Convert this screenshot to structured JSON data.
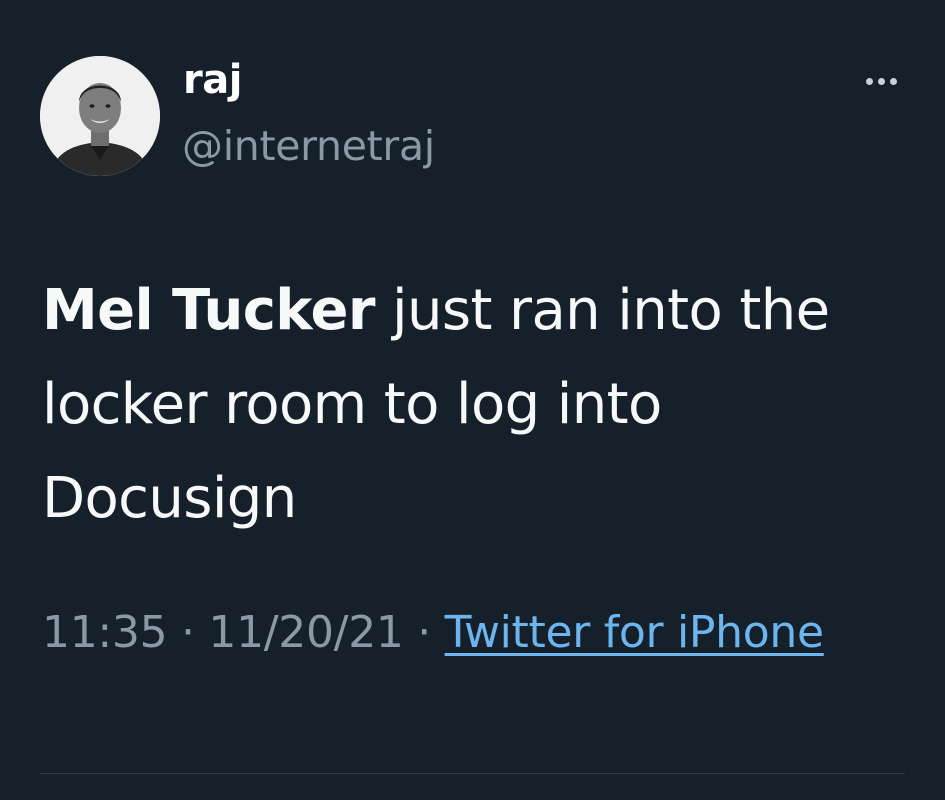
{
  "author": {
    "display_name": "raj",
    "handle": "@internetraj",
    "avatar_icon": "profile-photo"
  },
  "more_icon": "ellipsis-icon",
  "tweet": {
    "bold_text": "Mel Tucker",
    "text": " just ran into the locker room to log into Docusign"
  },
  "meta": {
    "time": "11:35",
    "separator_1": " · ",
    "date": "11/20/21",
    "separator_2": " · ",
    "source": "Twitter for iPhone"
  },
  "colors": {
    "background": "#16202b",
    "primary_text": "#ffffff",
    "secondary_text": "#8b98a5",
    "link": "#6cb5ee"
  }
}
